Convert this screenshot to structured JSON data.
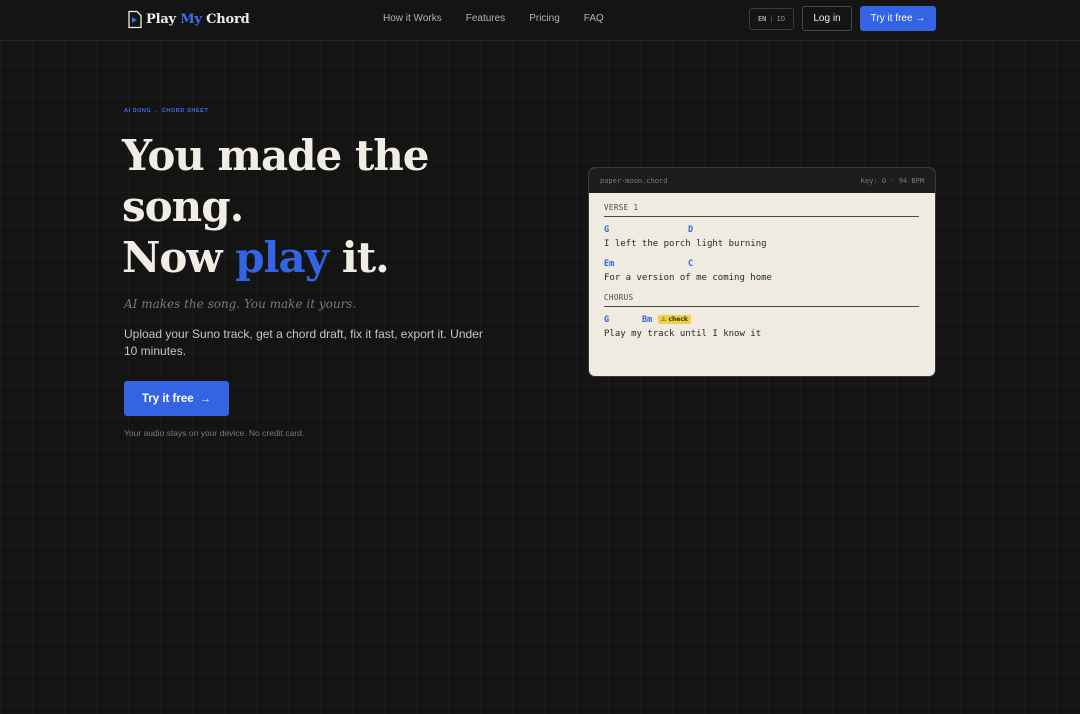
{
  "nav": {
    "logo": {
      "text_part1": "Play ",
      "text_accent": "My",
      "text_part2": " Chord",
      "icon": "music-file-icon"
    },
    "links": [
      "How it Works",
      "Features",
      "Pricing",
      "FAQ"
    ],
    "lang": {
      "active": "EN",
      "other": "ID"
    },
    "login_label": "Log in",
    "try_label": "Try it free →"
  },
  "hero": {
    "eyebrow": "AI SONG → CHORD SHEET",
    "headline": {
      "line1": "You made the",
      "line2": "song.",
      "line3_pre": "Now ",
      "line3_accent": "play",
      "line3_post": " it."
    },
    "tagline": "AI makes the song. You make it yours.",
    "description": "Upload your Suno track, get a chord draft, fix it fast, export it. Under 10 minutes.",
    "cta_label": "Try it free",
    "cta_arrow": "→",
    "fineprint": "Your audio stays on your device. No credit card."
  },
  "card": {
    "filename": "paper-moon.chord",
    "meta": "Key: G · 94 BPM",
    "verse_label": "VERSE 1",
    "verse_lines": [
      {
        "chords": [
          "G",
          "D"
        ],
        "lyric": "I left the porch light burning"
      },
      {
        "chords": [
          "Em",
          "C"
        ],
        "lyric": "For a version of me coming home"
      }
    ],
    "chorus_label": "CHORUS",
    "chorus_lines": [
      {
        "chords": [
          "G",
          "Bm"
        ],
        "badge": "⚠ check",
        "lyric": "Play my track until I know it"
      }
    ]
  },
  "colors": {
    "accent": "#3464e4",
    "background": "#141414",
    "paper": "#f0ebe0",
    "badge": "#f0cf4a"
  }
}
